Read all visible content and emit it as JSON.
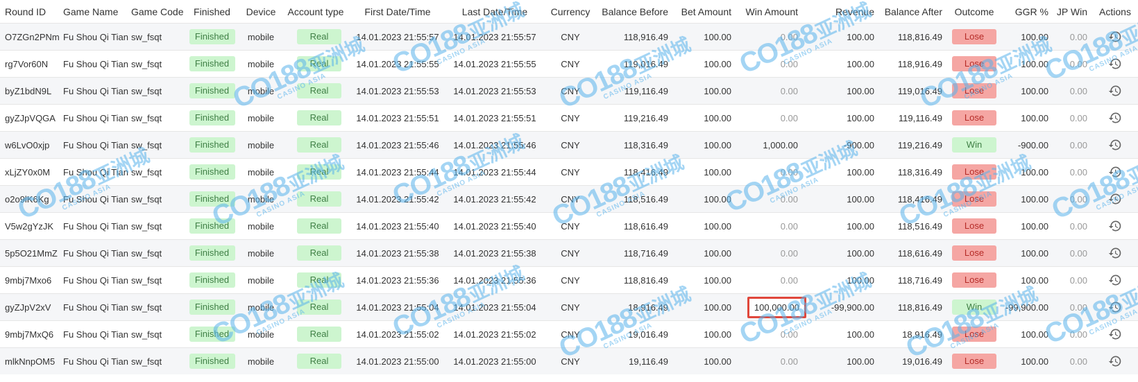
{
  "columns": {
    "round_id": "Round ID",
    "game_name": "Game Name",
    "game_code": "Game Code",
    "finished": "Finished",
    "device": "Device",
    "account_type": "Account type",
    "first_date": "First Date/Time",
    "last_date": "Last Date/Time",
    "currency": "Currency",
    "balance_before": "Balance Before",
    "bet_amount": "Bet Amount",
    "win_amount": "Win Amount",
    "revenue": "Revenue",
    "balance_after": "Balance After",
    "outcome": "Outcome",
    "ggr": "GGR %",
    "jp_win": "JP Win",
    "actions": "Actions"
  },
  "rows": [
    {
      "round_id": "O7ZGn2PNm",
      "game_name": "Fu Shou Qi Tian",
      "game_code": "sw_fsqt",
      "finished": "Finished",
      "device": "mobile",
      "account_type": "Real",
      "first_date": "14.01.2023 21:55:57",
      "last_date": "14.01.2023 21:55:57",
      "currency": "CNY",
      "balance_before": "118,916.49",
      "bet_amount": "100.00",
      "win_amount": "0.00",
      "revenue": "100.00",
      "balance_after": "118,816.49",
      "outcome": "Lose",
      "ggr": "100.00",
      "jp_win": "0.00"
    },
    {
      "round_id": "rg7Vor60N",
      "game_name": "Fu Shou Qi Tian",
      "game_code": "sw_fsqt",
      "finished": "Finished",
      "device": "mobile",
      "account_type": "Real",
      "first_date": "14.01.2023 21:55:55",
      "last_date": "14.01.2023 21:55:55",
      "currency": "CNY",
      "balance_before": "119,016.49",
      "bet_amount": "100.00",
      "win_amount": "0.00",
      "revenue": "100.00",
      "balance_after": "118,916.49",
      "outcome": "Lose",
      "ggr": "100.00",
      "jp_win": "0.00"
    },
    {
      "round_id": "byZ1bdN9L",
      "game_name": "Fu Shou Qi Tian",
      "game_code": "sw_fsqt",
      "finished": "Finished",
      "device": "mobile",
      "account_type": "Real",
      "first_date": "14.01.2023 21:55:53",
      "last_date": "14.01.2023 21:55:53",
      "currency": "CNY",
      "balance_before": "119,116.49",
      "bet_amount": "100.00",
      "win_amount": "0.00",
      "revenue": "100.00",
      "balance_after": "119,016.49",
      "outcome": "Lose",
      "ggr": "100.00",
      "jp_win": "0.00"
    },
    {
      "round_id": "gyZJpVQGA",
      "game_name": "Fu Shou Qi Tian",
      "game_code": "sw_fsqt",
      "finished": "Finished",
      "device": "mobile",
      "account_type": "Real",
      "first_date": "14.01.2023 21:55:51",
      "last_date": "14.01.2023 21:55:51",
      "currency": "CNY",
      "balance_before": "119,216.49",
      "bet_amount": "100.00",
      "win_amount": "0.00",
      "revenue": "100.00",
      "balance_after": "119,116.49",
      "outcome": "Lose",
      "ggr": "100.00",
      "jp_win": "0.00"
    },
    {
      "round_id": "w6LvO0xjp",
      "game_name": "Fu Shou Qi Tian",
      "game_code": "sw_fsqt",
      "finished": "Finished",
      "device": "mobile",
      "account_type": "Real",
      "first_date": "14.01.2023 21:55:46",
      "last_date": "14.01.2023 21:55:46",
      "currency": "CNY",
      "balance_before": "118,316.49",
      "bet_amount": "100.00",
      "win_amount": "1,000.00",
      "revenue": "-900.00",
      "balance_after": "119,216.49",
      "outcome": "Win",
      "ggr": "-900.00",
      "jp_win": "0.00"
    },
    {
      "round_id": "xLjZY0x0M",
      "game_name": "Fu Shou Qi Tian",
      "game_code": "sw_fsqt",
      "finished": "Finished",
      "device": "mobile",
      "account_type": "Real",
      "first_date": "14.01.2023 21:55:44",
      "last_date": "14.01.2023 21:55:44",
      "currency": "CNY",
      "balance_before": "118,416.49",
      "bet_amount": "100.00",
      "win_amount": "0.00",
      "revenue": "100.00",
      "balance_after": "118,316.49",
      "outcome": "Lose",
      "ggr": "100.00",
      "jp_win": "0.00"
    },
    {
      "round_id": "o2o9lK6Kg",
      "game_name": "Fu Shou Qi Tian",
      "game_code": "sw_fsqt",
      "finished": "Finished",
      "device": "mobile",
      "account_type": "Real",
      "first_date": "14.01.2023 21:55:42",
      "last_date": "14.01.2023 21:55:42",
      "currency": "CNY",
      "balance_before": "118,516.49",
      "bet_amount": "100.00",
      "win_amount": "0.00",
      "revenue": "100.00",
      "balance_after": "118,416.49",
      "outcome": "Lose",
      "ggr": "100.00",
      "jp_win": "0.00"
    },
    {
      "round_id": "V5w2gYzJK",
      "game_name": "Fu Shou Qi Tian",
      "game_code": "sw_fsqt",
      "finished": "Finished",
      "device": "mobile",
      "account_type": "Real",
      "first_date": "14.01.2023 21:55:40",
      "last_date": "14.01.2023 21:55:40",
      "currency": "CNY",
      "balance_before": "118,616.49",
      "bet_amount": "100.00",
      "win_amount": "0.00",
      "revenue": "100.00",
      "balance_after": "118,516.49",
      "outcome": "Lose",
      "ggr": "100.00",
      "jp_win": "0.00"
    },
    {
      "round_id": "5p5O21MmZ",
      "game_name": "Fu Shou Qi Tian",
      "game_code": "sw_fsqt",
      "finished": "Finished",
      "device": "mobile",
      "account_type": "Real",
      "first_date": "14.01.2023 21:55:38",
      "last_date": "14.01.2023 21:55:38",
      "currency": "CNY",
      "balance_before": "118,716.49",
      "bet_amount": "100.00",
      "win_amount": "0.00",
      "revenue": "100.00",
      "balance_after": "118,616.49",
      "outcome": "Lose",
      "ggr": "100.00",
      "jp_win": "0.00"
    },
    {
      "round_id": "9mbj7Mxo6",
      "game_name": "Fu Shou Qi Tian",
      "game_code": "sw_fsqt",
      "finished": "Finished",
      "device": "mobile",
      "account_type": "Real",
      "first_date": "14.01.2023 21:55:36",
      "last_date": "14.01.2023 21:55:36",
      "currency": "CNY",
      "balance_before": "118,816.49",
      "bet_amount": "100.00",
      "win_amount": "0.00",
      "revenue": "100.00",
      "balance_after": "118,716.49",
      "outcome": "Lose",
      "ggr": "100.00",
      "jp_win": "0.00"
    },
    {
      "round_id": "gyZJpV2xV",
      "game_name": "Fu Shou Qi Tian",
      "game_code": "sw_fsqt",
      "finished": "Finished",
      "device": "mobile",
      "account_type": "Real",
      "first_date": "14.01.2023 21:55:04",
      "last_date": "14.01.2023 21:55:04",
      "currency": "CNY",
      "balance_before": "18,916.49",
      "bet_amount": "100.00",
      "win_amount": "100,000.00",
      "revenue": "-99,900.00",
      "balance_after": "118,816.49",
      "outcome": "Win",
      "ggr": "-99,900.00",
      "jp_win": "0.00",
      "highlight_win": true
    },
    {
      "round_id": "9mbj7MxQ6",
      "game_name": "Fu Shou Qi Tian",
      "game_code": "sw_fsqt",
      "finished": "Finished",
      "device": "mobile",
      "account_type": "Real",
      "first_date": "14.01.2023 21:55:02",
      "last_date": "14.01.2023 21:55:02",
      "currency": "CNY",
      "balance_before": "19,016.49",
      "bet_amount": "100.00",
      "win_amount": "0.00",
      "revenue": "100.00",
      "balance_after": "18,916.49",
      "outcome": "Lose",
      "ggr": "100.00",
      "jp_win": "0.00"
    },
    {
      "round_id": "mlkNnpOM5",
      "game_name": "Fu Shou Qi Tian",
      "game_code": "sw_fsqt",
      "finished": "Finished",
      "device": "mobile",
      "account_type": "Real",
      "first_date": "14.01.2023 21:55:00",
      "last_date": "14.01.2023 21:55:00",
      "currency": "CNY",
      "balance_before": "19,116.49",
      "bet_amount": "100.00",
      "win_amount": "0.00",
      "revenue": "100.00",
      "balance_after": "19,016.49",
      "outcome": "Lose",
      "ggr": "100.00",
      "jp_win": "0.00"
    }
  ],
  "icons": {
    "actions": "history-icon"
  },
  "colors": {
    "finished_bg": "#cdf5cf",
    "lose_bg": "#f5a6a3",
    "win_bg": "#cdf5cf",
    "highlight_border": "#e0473b",
    "watermark": "#5ab4ec"
  },
  "watermark": {
    "logo": "CO188",
    "cn": "亚洲城",
    "sub": "CASINO ASIA"
  }
}
